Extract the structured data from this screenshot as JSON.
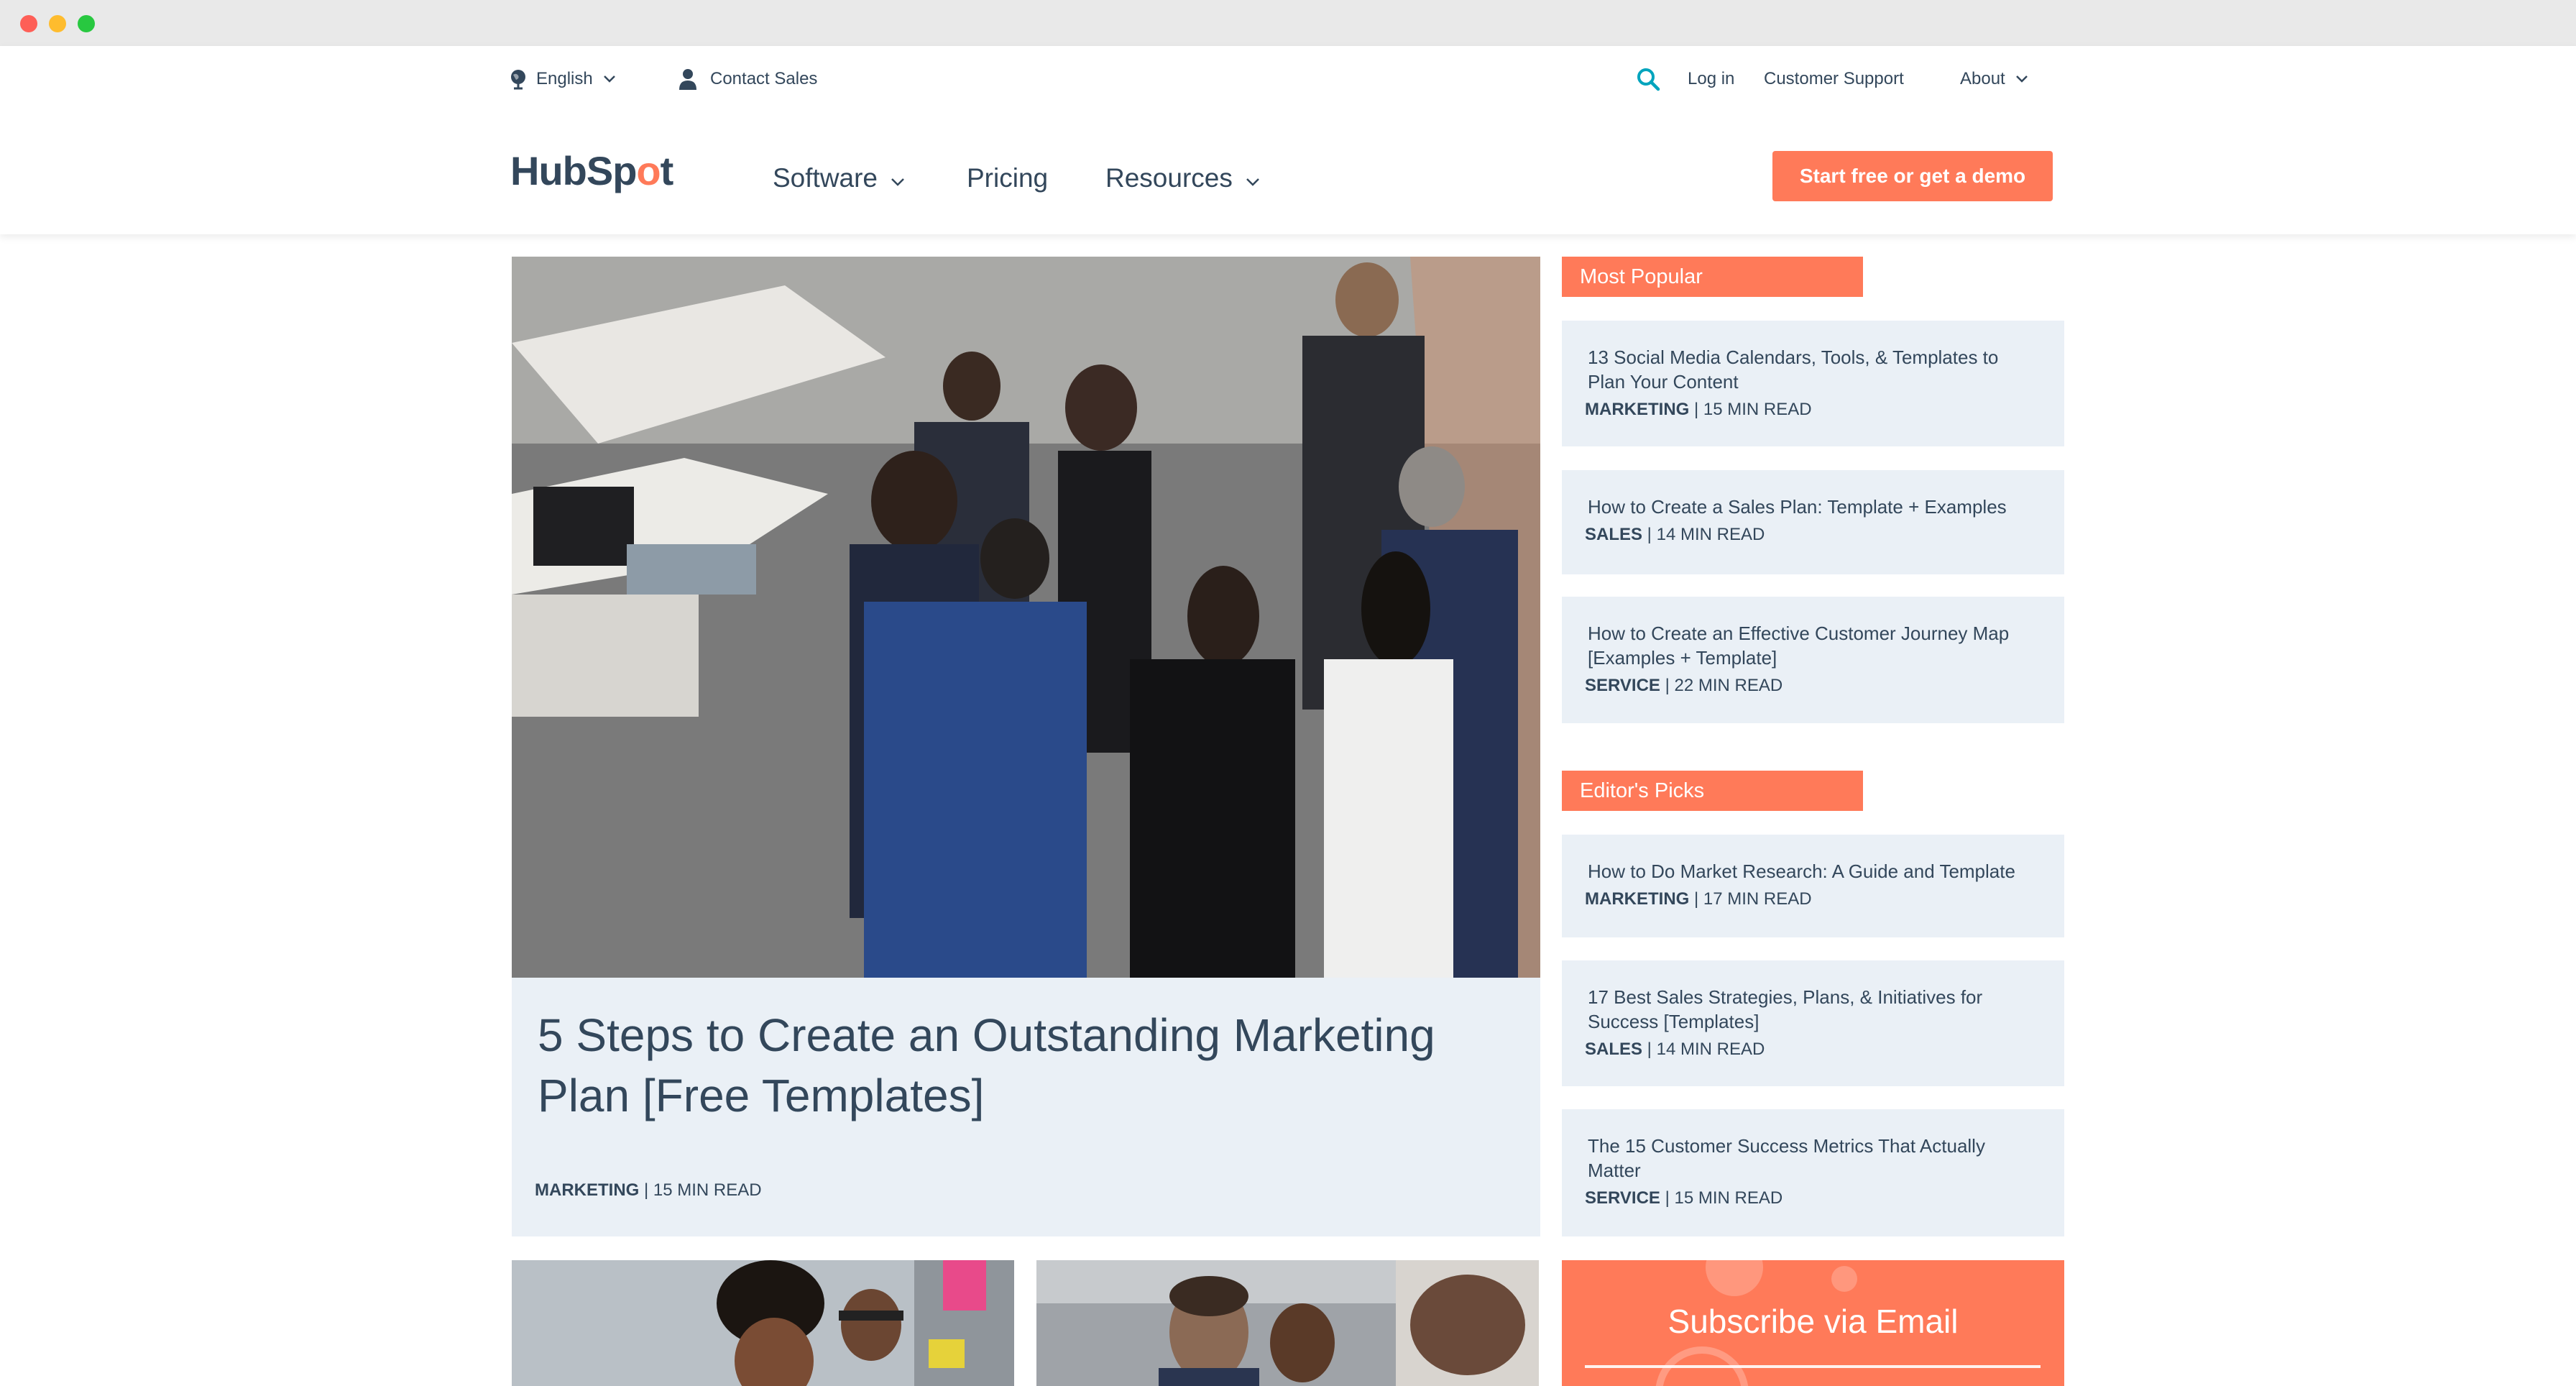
{
  "utility_nav": {
    "language": "English",
    "contact_sales": "Contact Sales",
    "log_in": "Log in",
    "customer_support": "Customer Support",
    "about": "About"
  },
  "logo": {
    "text_a": "HubSp",
    "text_b": "t"
  },
  "main_nav": {
    "software": "Software",
    "pricing": "Pricing",
    "resources": "Resources",
    "cta": "Start free or get a demo"
  },
  "hero": {
    "title": "5 Steps to Create an Outstanding Marketing Plan [Free Templates]",
    "category": "MARKETING",
    "read_time": "15 MIN READ"
  },
  "most_popular": {
    "label": "Most Popular",
    "items": [
      {
        "title": "13 Social Media Calendars, Tools, & Templates to Plan Your Content",
        "category": "MARKETING",
        "read_time": "15 MIN READ"
      },
      {
        "title": "How to Create a Sales Plan: Template + Examples",
        "category": "SALES",
        "read_time": "14 MIN READ"
      },
      {
        "title": "How to Create an Effective Customer Journey Map [Examples + Template]",
        "category": "SERVICE",
        "read_time": "22 MIN READ"
      }
    ]
  },
  "editors_picks": {
    "label": "Editor's Picks",
    "items": [
      {
        "title": "How to Do Market Research: A Guide and Template",
        "category": "MARKETING",
        "read_time": "17 MIN READ"
      },
      {
        "title": "17 Best Sales Strategies, Plans, & Initiatives for Success [Templates]",
        "category": "SALES",
        "read_time": "14 MIN READ"
      },
      {
        "title": "The 15 Customer Success Metrics That Actually Matter",
        "category": "SERVICE",
        "read_time": "15 MIN READ"
      }
    ]
  },
  "subscribe": {
    "title": "Subscribe via Email"
  },
  "colors": {
    "accent": "#ff7a59",
    "text": "#33475b",
    "card_bg": "#eaf0f6",
    "search_icon": "#00a4bd"
  },
  "icons": [
    "globe-icon",
    "person-icon",
    "search-icon",
    "chevron-down-icon",
    "hubspot-sprocket-icon"
  ]
}
